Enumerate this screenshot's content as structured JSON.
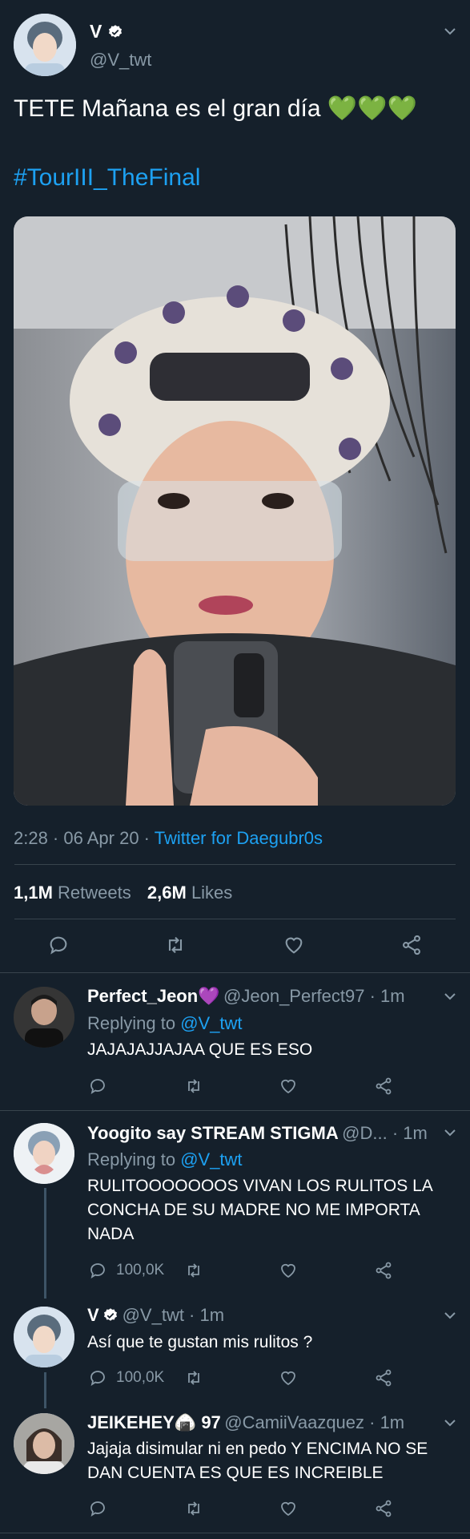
{
  "tweet": {
    "display_name": "V",
    "handle": "@V_twt",
    "text": "TETE Mañana es el gran día 💚💚💚",
    "hashtag": "#TourIII_TheFinal",
    "time": "2:28 · 06 Apr 20 · ",
    "source": "Twitter for Daegubr0s",
    "retweets_count": "1,1M",
    "retweets_label": "Retweets",
    "likes_count": "2,6M",
    "likes_label": "Likes"
  },
  "replies": [
    {
      "name": "Perfect_Jeon💜",
      "handle": "@Jeon_Perfect97 · 1m",
      "replying_prefix": "Replying to ",
      "replying_to": "@V_twt",
      "text": "JAJAJAJJAJAA QUE ES ESO",
      "reply_count": "",
      "retweet_count": ""
    },
    {
      "name": "Yoogito say STREAM STIGMA",
      "handle": "@D... · 1m",
      "replying_prefix": "Replying to ",
      "replying_to": "@V_twt",
      "text": "RULITOOOOOOOS VIVAN LOS RULITOS LA CONCHA DE SU MADRE NO ME IMPORTA NADA",
      "reply_count": "100,0K",
      "retweet_count": ""
    },
    {
      "name": "V",
      "handle": "@V_twt · 1m",
      "text": "Así que te gustan mis rulitos ?",
      "reply_count": "100,0K",
      "retweet_count": ""
    },
    {
      "name": "JEIKEHEY🍙 97",
      "handle": "@CamiiVaazquez · 1m",
      "text": "Jajaja disimular ni en pedo Y ENCIMA NO SE DAN CUENTA ES QUE ES INCREIBLE",
      "reply_count": "",
      "retweet_count": ""
    }
  ],
  "colors": {
    "background": "#15202b",
    "accent": "#1da1f2",
    "muted": "#8899a6",
    "divider": "#38444d"
  },
  "icons": [
    "reply-icon",
    "retweet-icon",
    "like-icon",
    "share-icon",
    "verified-icon",
    "chevron-down-icon"
  ]
}
